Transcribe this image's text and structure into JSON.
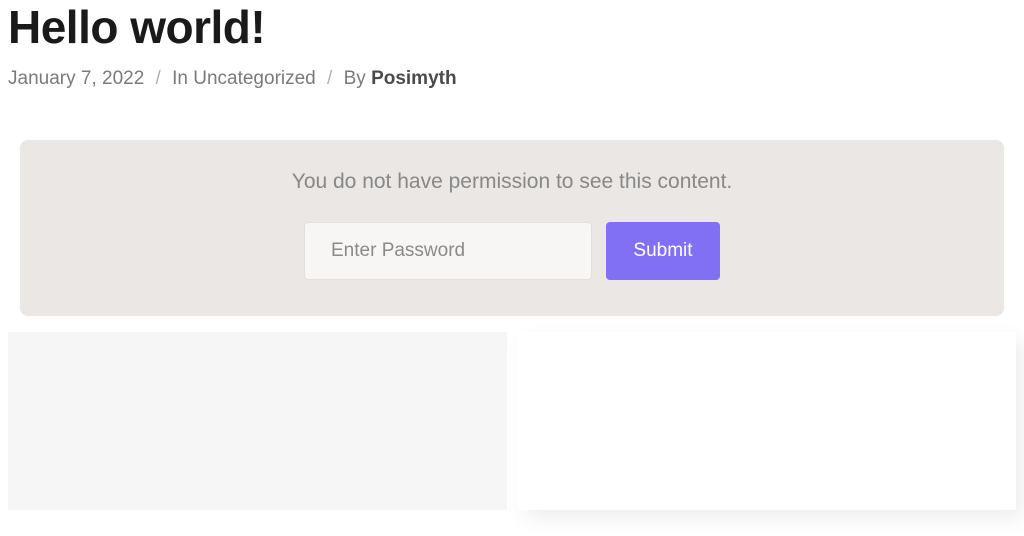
{
  "page": {
    "title": "Hello world!"
  },
  "meta": {
    "date": "January 7, 2022",
    "category_prefix": "In ",
    "category": "Uncategorized",
    "author_prefix": "By ",
    "author": "Posimyth"
  },
  "protected": {
    "message": "You do not have permission to see this content.",
    "password_placeholder": "Enter Password",
    "submit_label": "Submit"
  },
  "colors": {
    "accent": "#8170f3",
    "box_bg": "#eae7e4",
    "panel_bg": "#f6f6f6"
  }
}
